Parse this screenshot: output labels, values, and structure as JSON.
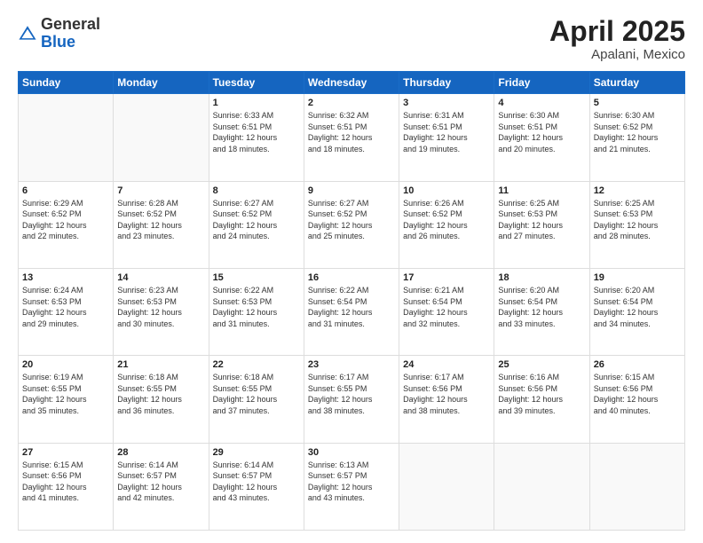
{
  "header": {
    "logo_general": "General",
    "logo_blue": "Blue",
    "title": "April 2025",
    "location": "Apalani, Mexico"
  },
  "weekdays": [
    "Sunday",
    "Monday",
    "Tuesday",
    "Wednesday",
    "Thursday",
    "Friday",
    "Saturday"
  ],
  "weeks": [
    [
      {
        "day": "",
        "info": ""
      },
      {
        "day": "",
        "info": ""
      },
      {
        "day": "1",
        "info": "Sunrise: 6:33 AM\nSunset: 6:51 PM\nDaylight: 12 hours\nand 18 minutes."
      },
      {
        "day": "2",
        "info": "Sunrise: 6:32 AM\nSunset: 6:51 PM\nDaylight: 12 hours\nand 18 minutes."
      },
      {
        "day": "3",
        "info": "Sunrise: 6:31 AM\nSunset: 6:51 PM\nDaylight: 12 hours\nand 19 minutes."
      },
      {
        "day": "4",
        "info": "Sunrise: 6:30 AM\nSunset: 6:51 PM\nDaylight: 12 hours\nand 20 minutes."
      },
      {
        "day": "5",
        "info": "Sunrise: 6:30 AM\nSunset: 6:52 PM\nDaylight: 12 hours\nand 21 minutes."
      }
    ],
    [
      {
        "day": "6",
        "info": "Sunrise: 6:29 AM\nSunset: 6:52 PM\nDaylight: 12 hours\nand 22 minutes."
      },
      {
        "day": "7",
        "info": "Sunrise: 6:28 AM\nSunset: 6:52 PM\nDaylight: 12 hours\nand 23 minutes."
      },
      {
        "day": "8",
        "info": "Sunrise: 6:27 AM\nSunset: 6:52 PM\nDaylight: 12 hours\nand 24 minutes."
      },
      {
        "day": "9",
        "info": "Sunrise: 6:27 AM\nSunset: 6:52 PM\nDaylight: 12 hours\nand 25 minutes."
      },
      {
        "day": "10",
        "info": "Sunrise: 6:26 AM\nSunset: 6:52 PM\nDaylight: 12 hours\nand 26 minutes."
      },
      {
        "day": "11",
        "info": "Sunrise: 6:25 AM\nSunset: 6:53 PM\nDaylight: 12 hours\nand 27 minutes."
      },
      {
        "day": "12",
        "info": "Sunrise: 6:25 AM\nSunset: 6:53 PM\nDaylight: 12 hours\nand 28 minutes."
      }
    ],
    [
      {
        "day": "13",
        "info": "Sunrise: 6:24 AM\nSunset: 6:53 PM\nDaylight: 12 hours\nand 29 minutes."
      },
      {
        "day": "14",
        "info": "Sunrise: 6:23 AM\nSunset: 6:53 PM\nDaylight: 12 hours\nand 30 minutes."
      },
      {
        "day": "15",
        "info": "Sunrise: 6:22 AM\nSunset: 6:53 PM\nDaylight: 12 hours\nand 31 minutes."
      },
      {
        "day": "16",
        "info": "Sunrise: 6:22 AM\nSunset: 6:54 PM\nDaylight: 12 hours\nand 31 minutes."
      },
      {
        "day": "17",
        "info": "Sunrise: 6:21 AM\nSunset: 6:54 PM\nDaylight: 12 hours\nand 32 minutes."
      },
      {
        "day": "18",
        "info": "Sunrise: 6:20 AM\nSunset: 6:54 PM\nDaylight: 12 hours\nand 33 minutes."
      },
      {
        "day": "19",
        "info": "Sunrise: 6:20 AM\nSunset: 6:54 PM\nDaylight: 12 hours\nand 34 minutes."
      }
    ],
    [
      {
        "day": "20",
        "info": "Sunrise: 6:19 AM\nSunset: 6:55 PM\nDaylight: 12 hours\nand 35 minutes."
      },
      {
        "day": "21",
        "info": "Sunrise: 6:18 AM\nSunset: 6:55 PM\nDaylight: 12 hours\nand 36 minutes."
      },
      {
        "day": "22",
        "info": "Sunrise: 6:18 AM\nSunset: 6:55 PM\nDaylight: 12 hours\nand 37 minutes."
      },
      {
        "day": "23",
        "info": "Sunrise: 6:17 AM\nSunset: 6:55 PM\nDaylight: 12 hours\nand 38 minutes."
      },
      {
        "day": "24",
        "info": "Sunrise: 6:17 AM\nSunset: 6:56 PM\nDaylight: 12 hours\nand 38 minutes."
      },
      {
        "day": "25",
        "info": "Sunrise: 6:16 AM\nSunset: 6:56 PM\nDaylight: 12 hours\nand 39 minutes."
      },
      {
        "day": "26",
        "info": "Sunrise: 6:15 AM\nSunset: 6:56 PM\nDaylight: 12 hours\nand 40 minutes."
      }
    ],
    [
      {
        "day": "27",
        "info": "Sunrise: 6:15 AM\nSunset: 6:56 PM\nDaylight: 12 hours\nand 41 minutes."
      },
      {
        "day": "28",
        "info": "Sunrise: 6:14 AM\nSunset: 6:57 PM\nDaylight: 12 hours\nand 42 minutes."
      },
      {
        "day": "29",
        "info": "Sunrise: 6:14 AM\nSunset: 6:57 PM\nDaylight: 12 hours\nand 43 minutes."
      },
      {
        "day": "30",
        "info": "Sunrise: 6:13 AM\nSunset: 6:57 PM\nDaylight: 12 hours\nand 43 minutes."
      },
      {
        "day": "",
        "info": ""
      },
      {
        "day": "",
        "info": ""
      },
      {
        "day": "",
        "info": ""
      }
    ]
  ]
}
